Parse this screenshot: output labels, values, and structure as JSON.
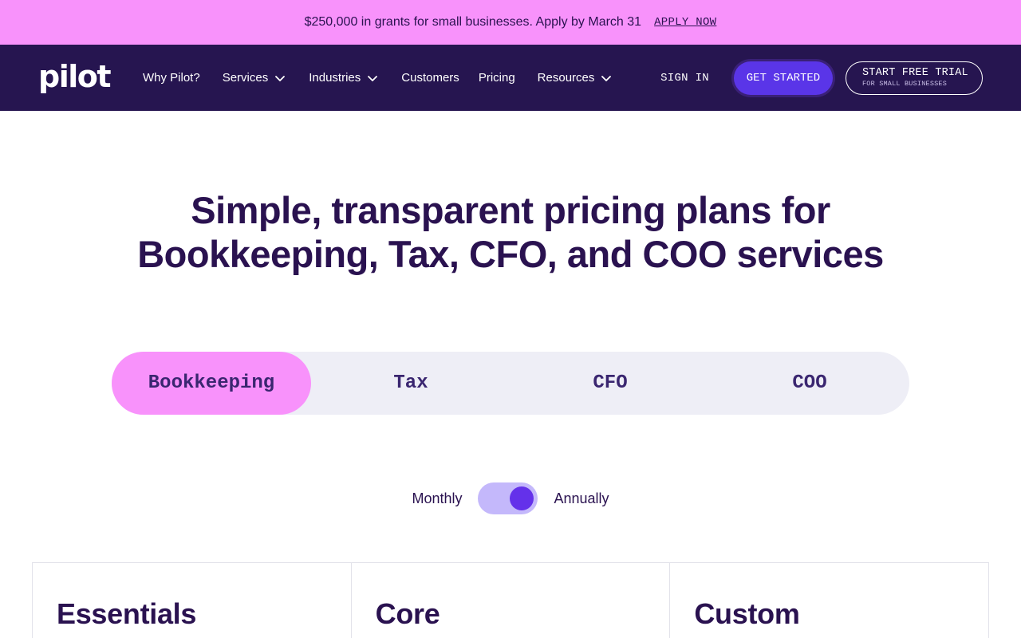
{
  "promo": {
    "text": "$250,000 in grants for small businesses. Apply by March 31",
    "link": "APPLY NOW"
  },
  "nav": {
    "logo": "pilot",
    "links": [
      {
        "label": "Why Pilot?",
        "dropdown": false
      },
      {
        "label": "Services",
        "dropdown": true
      },
      {
        "label": "Industries",
        "dropdown": true
      },
      {
        "label": "Customers",
        "dropdown": false
      },
      {
        "label": "Pricing",
        "dropdown": false
      },
      {
        "label": "Resources",
        "dropdown": true
      }
    ],
    "sign_in": "SIGN IN",
    "get_started": "GET STARTED",
    "trial_main": "START FREE TRIAL",
    "trial_sub": "FOR SMALL BUSINESSES"
  },
  "hero": {
    "line1": "Simple, transparent pricing plans for",
    "line2": "Bookkeeping, Tax, CFO, and COO services"
  },
  "tabs": [
    {
      "label": "Bookkeeping",
      "active": true
    },
    {
      "label": "Tax",
      "active": false
    },
    {
      "label": "CFO",
      "active": false
    },
    {
      "label": "COO",
      "active": false
    }
  ],
  "billing": {
    "monthly": "Monthly",
    "annually": "Annually",
    "selected": "Annually"
  },
  "plans": [
    {
      "name": "Essentials"
    },
    {
      "name": "Core"
    },
    {
      "name": "Custom"
    }
  ],
  "colors": {
    "promo_bg": "#f892fb",
    "nav_bg": "#261550",
    "accent": "#5a35e8",
    "text_dark": "#2a1250",
    "tab_track": "#eeeef6",
    "toggle_track": "#c4b8fb",
    "toggle_knob": "#6431ea"
  },
  "icons": {
    "dropdown": "chevron-down-icon"
  }
}
